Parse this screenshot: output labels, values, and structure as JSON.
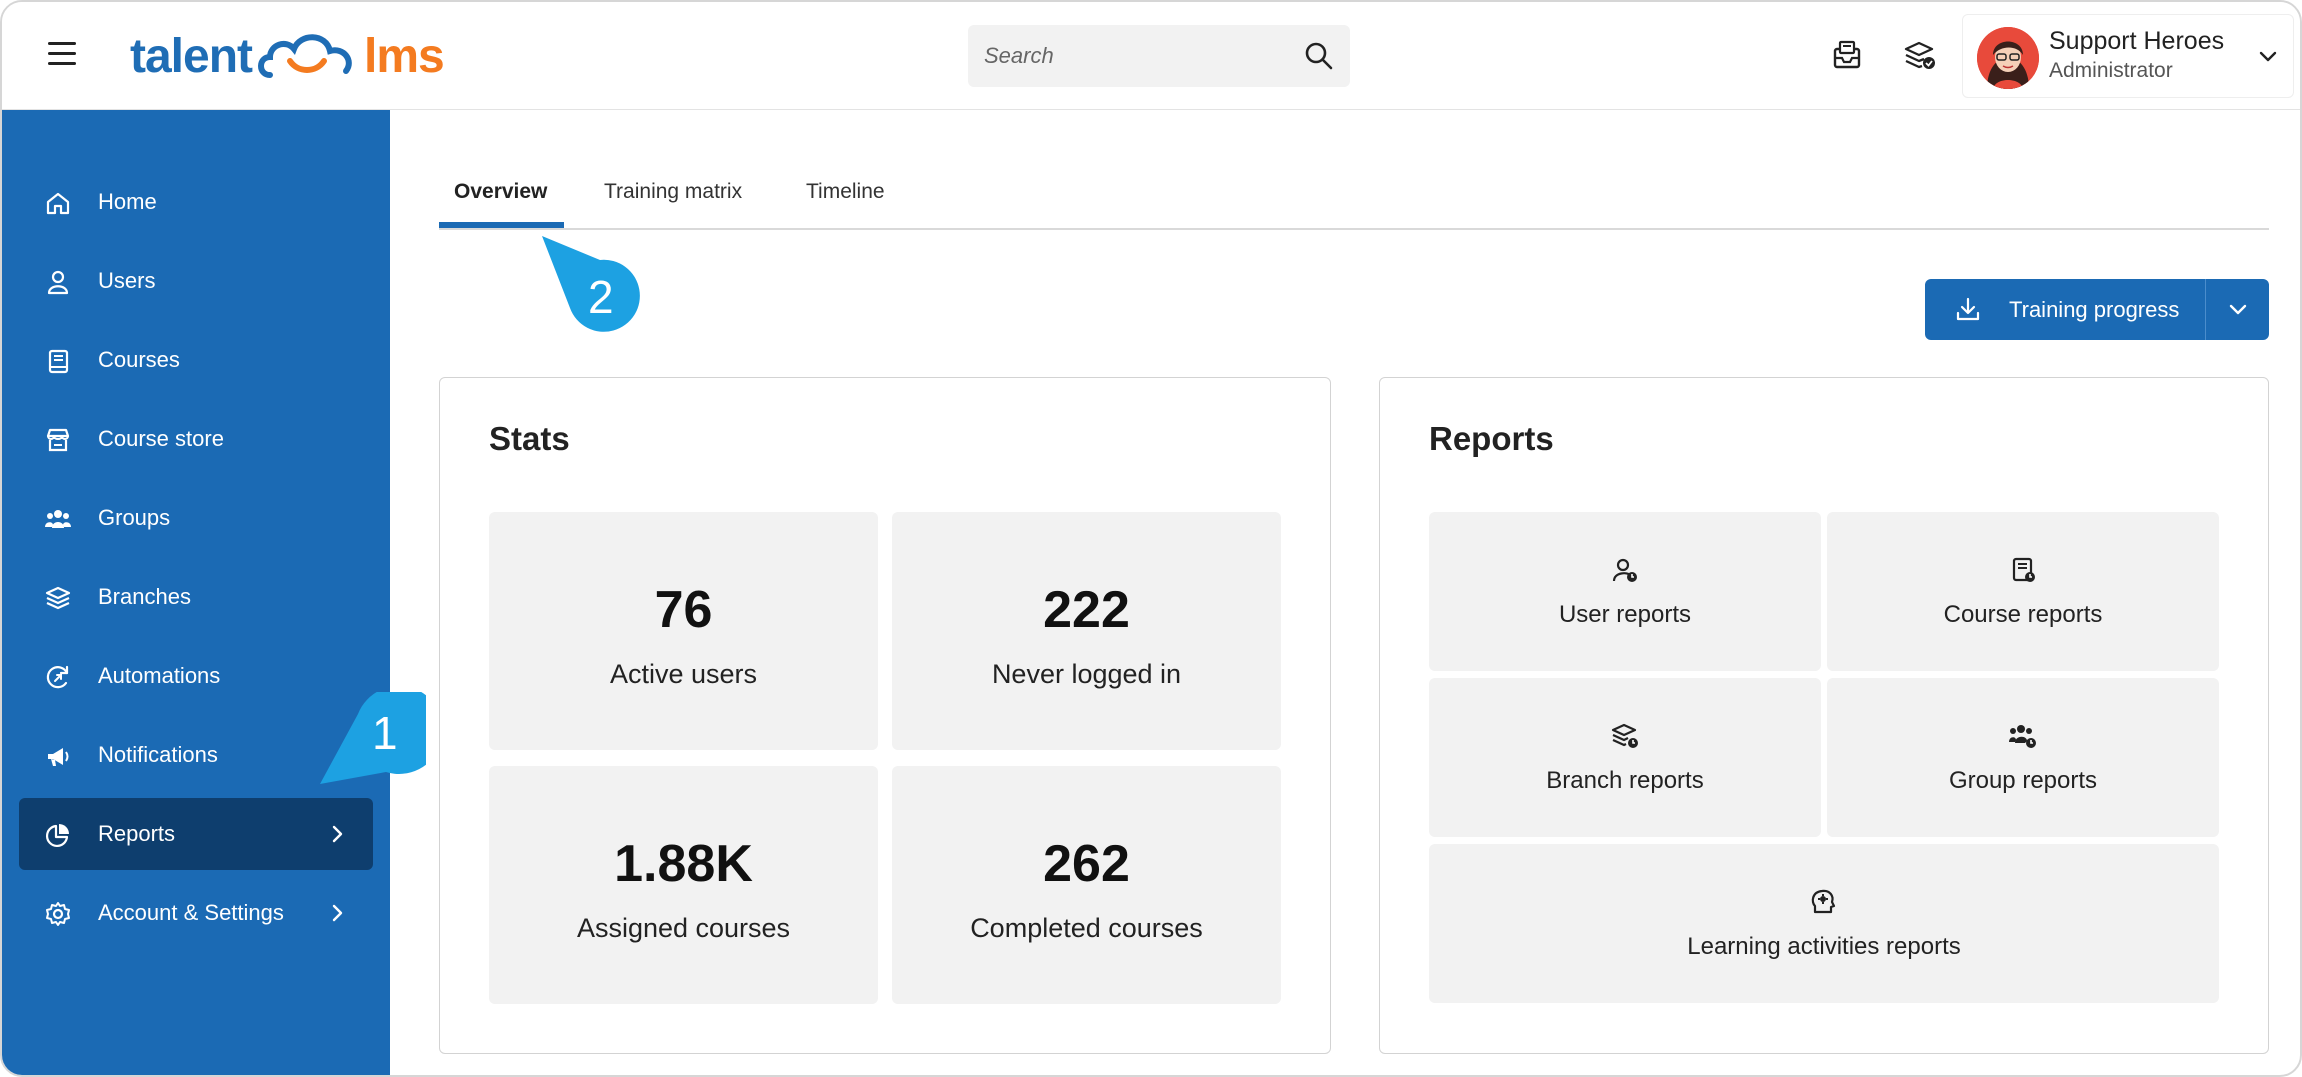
{
  "app": {
    "logo_left": "talent",
    "logo_right": "lms"
  },
  "search": {
    "placeholder": "Search"
  },
  "user": {
    "name": "Support Heroes",
    "role": "Administrator"
  },
  "sidebar": {
    "items": [
      {
        "label": "Home",
        "icon": "home-icon"
      },
      {
        "label": "Users",
        "icon": "user-icon"
      },
      {
        "label": "Courses",
        "icon": "book-icon"
      },
      {
        "label": "Course store",
        "icon": "store-icon"
      },
      {
        "label": "Groups",
        "icon": "groups-icon"
      },
      {
        "label": "Branches",
        "icon": "layers-icon"
      },
      {
        "label": "Automations",
        "icon": "automation-icon"
      },
      {
        "label": "Notifications",
        "icon": "megaphone-icon"
      },
      {
        "label": "Reports",
        "icon": "pie-chart-icon",
        "active": true
      },
      {
        "label": "Account & Settings",
        "icon": "gear-icon"
      }
    ]
  },
  "tabs": [
    {
      "label": "Overview",
      "active": true
    },
    {
      "label": "Training matrix"
    },
    {
      "label": "Timeline"
    }
  ],
  "callouts": {
    "one": "1",
    "two": "2"
  },
  "actions": {
    "training_progress": "Training progress"
  },
  "stats": {
    "title": "Stats",
    "cards": [
      {
        "value": "76",
        "label": "Active users"
      },
      {
        "value": "222",
        "label": "Never logged in"
      },
      {
        "value": "1.88K",
        "label": "Assigned courses"
      },
      {
        "value": "262",
        "label": "Completed courses"
      }
    ]
  },
  "reports": {
    "title": "Reports",
    "cards": [
      {
        "label": "User reports",
        "icon": "user-report-icon"
      },
      {
        "label": "Course reports",
        "icon": "course-report-icon"
      },
      {
        "label": "Branch reports",
        "icon": "branch-report-icon"
      },
      {
        "label": "Group reports",
        "icon": "group-report-icon"
      },
      {
        "label": "Learning activities reports",
        "icon": "learning-activities-icon"
      }
    ]
  },
  "colors": {
    "primary": "#1b6ab4",
    "sidebar_active": "#0e3e6e",
    "callout": "#1da1e2",
    "logo_orange": "#f47b20"
  }
}
